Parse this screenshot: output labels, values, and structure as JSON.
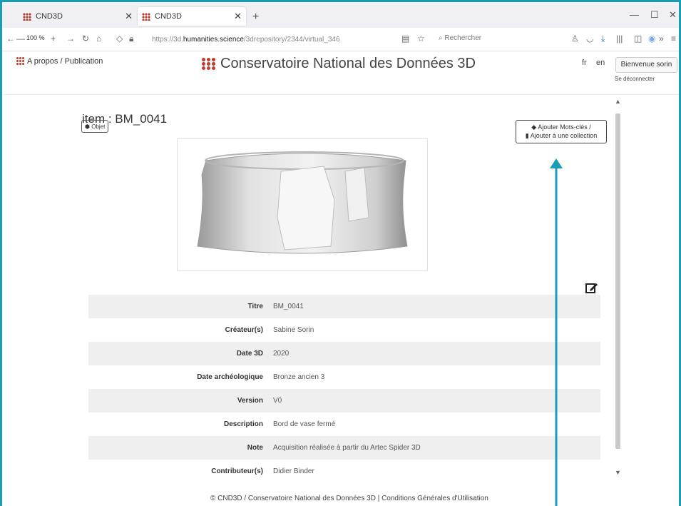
{
  "browser": {
    "tabs": [
      {
        "label": "CND3D"
      },
      {
        "label": "CND3D"
      }
    ],
    "zoom": "100 %",
    "url_prefix": "https://3d.",
    "url_domain": "humanities.science",
    "url_path": "/3drepository/2344/virtual_346",
    "search_placeholder": "Rechercher"
  },
  "site": {
    "about_label": "A propos / Publication",
    "title": "Conservatoire National des Données 3D",
    "lang_fr": "fr",
    "lang_en": "en",
    "welcome_label": "Bienvenue sorin",
    "logout_label": "Se déconnecter"
  },
  "item": {
    "title": "item : BM_0041",
    "type_badge": "Objet",
    "keywords_button_line1": "Ajouter Mots-clés /",
    "keywords_button_line2": "Ajouter à une collection"
  },
  "metadata": [
    {
      "key": "Titre",
      "value": "BM_0041"
    },
    {
      "key": "Créateur(s)",
      "value": "Sabine Sorin"
    },
    {
      "key": "Date 3D",
      "value": "2020"
    },
    {
      "key": "Date archéologique",
      "value": "Bronze ancien 3"
    },
    {
      "key": "Version",
      "value": "V0"
    },
    {
      "key": "Description",
      "value": "Bord de vase fermé"
    },
    {
      "key": "Note",
      "value": "Acquisition réalisée à partir du Artec Spider 3D"
    },
    {
      "key": "Contributeur(s)",
      "value": "Didier Binder"
    }
  ],
  "footer": "© CND3D / Conservatoire National des Données 3D | Conditions Générales d'Utilisation",
  "colors": {
    "frame": "#1a9cb5",
    "logo": "#c0392b",
    "arrow": "#1a9cb5"
  }
}
